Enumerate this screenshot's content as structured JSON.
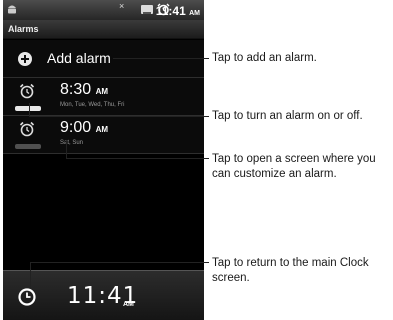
{
  "status_bar": {
    "time": "11:41",
    "ampm": "AM",
    "notification_glyph": "×"
  },
  "title": "Alarms",
  "add_alarm": {
    "label": "Add alarm"
  },
  "alarms": [
    {
      "time": "8:30",
      "ampm": "AM",
      "days": "Mon, Tue, Wed, Thu, Fri",
      "enabled": true
    },
    {
      "time": "9:00",
      "ampm": "AM",
      "days": "Sat, Sun",
      "enabled": false
    }
  ],
  "bottom_bar": {
    "time": "11:41",
    "ampm": "AM"
  },
  "callouts": {
    "add": "Tap to add an alarm.",
    "toggle": "Tap to turn an alarm on or off.",
    "open_line1": "Tap to open a screen where you",
    "open_line2": "can customize an alarm.",
    "clock_line1": "Tap to return to the main Clock",
    "clock_line2": "screen."
  }
}
